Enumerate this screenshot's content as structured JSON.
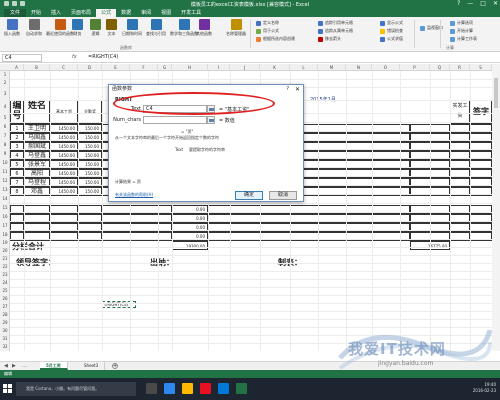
{
  "window": {
    "title": "模板员工的excel工资表模板.xlsx  [兼容模式] - Excel",
    "controls": [
      "?",
      "—",
      "□",
      "✕"
    ]
  },
  "ribbon": {
    "tabs": [
      {
        "label": "文件",
        "kind": "file"
      },
      {
        "label": "开始",
        "kind": "normal"
      },
      {
        "label": "插入",
        "kind": "normal"
      },
      {
        "label": "页面布局",
        "kind": "normal"
      },
      {
        "label": "公式",
        "kind": "active"
      },
      {
        "label": "数据",
        "kind": "normal"
      },
      {
        "label": "审阅",
        "kind": "normal"
      },
      {
        "label": "视图",
        "kind": "normal"
      },
      {
        "label": "开发工具",
        "kind": "normal"
      }
    ],
    "big_buttons": [
      {
        "label": "插入函数",
        "color": "#4472c4"
      },
      {
        "label": "自动求和",
        "color": "#6d6d6d"
      },
      {
        "label": "最近使用的函数",
        "color": "#c55a11"
      },
      {
        "label": "财务",
        "color": "#2e75b6"
      },
      {
        "label": "逻辑",
        "color": "#548235"
      },
      {
        "label": "文本",
        "color": "#7f6000"
      },
      {
        "label": "日期和时间",
        "color": "#2e75b6"
      },
      {
        "label": "查找与引用",
        "color": "#2e75b6"
      },
      {
        "label": "数学和三角函数",
        "color": "#2e75b6"
      },
      {
        "label": "其他函数",
        "color": "#7030a0"
      },
      {
        "label": "名称管理器",
        "color": "#bf8f00"
      }
    ],
    "small_buttons": [
      {
        "label": "定义名称",
        "color": "#4472c4"
      },
      {
        "label": "用于公式",
        "color": "#70ad47"
      },
      {
        "label": "根据所选内容创建",
        "color": "#ed7d31"
      },
      {
        "label": "追踪引用单元格",
        "color": "#4472c4"
      },
      {
        "label": "追踪从属单元格",
        "color": "#4472c4"
      },
      {
        "label": "移去箭头",
        "color": "#c00000"
      },
      {
        "label": "显示公式",
        "color": "#4472c4"
      },
      {
        "label": "错误检查",
        "color": "#ffc000"
      },
      {
        "label": "公式求值",
        "color": "#4472c4"
      },
      {
        "label": "监视窗口",
        "color": "#5b9bd5"
      },
      {
        "label": "计算选项",
        "color": "#5b9bd5"
      },
      {
        "label": "开始计算",
        "color": "#5b9bd5"
      },
      {
        "label": "计算工作表",
        "color": "#5b9bd5"
      }
    ],
    "groups": [
      "函数库",
      "计算"
    ]
  },
  "formula_bar": {
    "name_box": "C4",
    "fx": "fx",
    "formula": "=RIGHT(C4)"
  },
  "grid": {
    "columns": [
      "A",
      "B",
      "C",
      "D",
      "E",
      "F",
      "G",
      "H",
      "I",
      "J",
      "K",
      "L",
      "M",
      "N",
      "O",
      "P",
      "Q",
      "R",
      "S"
    ],
    "rows": [
      "1",
      "2",
      "3",
      "4",
      "5",
      "6",
      "7",
      "8",
      "9",
      "10",
      "11",
      "12",
      "13",
      "14",
      "15",
      "16",
      "17",
      "18",
      "19",
      "20",
      "21",
      "22",
      "23",
      "24",
      "25",
      "26",
      "27",
      "28",
      "29",
      "30",
      "31",
      "32",
      "33",
      "34"
    ]
  },
  "sheet": {
    "header_number": "编号",
    "header_name": "姓名",
    "header_basic": "基本工资",
    "header_total": "全勤奖",
    "header_real": "实发工资",
    "header_sign": "签字",
    "date_label": "2015年1月",
    "employees": [
      {
        "num": "1",
        "name": "王卫明",
        "basic": "1450.00",
        "total": "150.00"
      },
      {
        "num": "2",
        "name": "马国鑫",
        "basic": "1450.00",
        "total": "150.00"
      },
      {
        "num": "3",
        "name": "郝国斌",
        "basic": "1450.00",
        "total": "150.00"
      },
      {
        "num": "4",
        "name": "马登鑫",
        "basic": "1450.00",
        "total": "150.00"
      },
      {
        "num": "5",
        "name": "张景军",
        "basic": "1450.00",
        "total": "150.00"
      },
      {
        "num": "6",
        "name": "高阳",
        "basic": "1450.00",
        "total": "150.00"
      },
      {
        "num": "7",
        "name": "马登程",
        "basic": "1450.00",
        "total": "150.00"
      },
      {
        "num": "8",
        "name": "邓鑫",
        "basic": "1450.00",
        "total": "150.00"
      }
    ],
    "extra_values": [
      "0.00",
      "0.00",
      "0.00",
      "0.00"
    ],
    "subtotal_label": "分栏合计",
    "subtotal_value": "19300.00",
    "subtotal_right": "16775.00",
    "sign_leader": "领导签字：",
    "sign_cashier": "出纳：",
    "sign_maker": "制表：",
    "selected_cell_text": "=RIGHT(C4)"
  },
  "dialog": {
    "title": "函数参数",
    "help": "?",
    "close": "✕",
    "function_name": "RIGHT",
    "arg1_label": "Text",
    "arg1_value": "C4",
    "arg1_result": "= \"基本工资\"",
    "arg2_label": "Num_chars",
    "arg2_result": "= 数值",
    "result_preview": "= \"资\"",
    "description": "从一个文本字符串的最后一个字符开始返回指定个数的字符",
    "arg_help_label": "Text",
    "arg_help": "要提取字符的字符串",
    "calc_result": "计算结果 = 资",
    "help_link": "有关该函数的帮助(H)",
    "ok": "确定",
    "cancel": "取消"
  },
  "sheet_tabs": {
    "tabs": [
      "5月工资",
      "Sheet3"
    ],
    "add": "+"
  },
  "statusbar": {
    "text": "编辑"
  },
  "taskbar": {
    "search_placeholder": "我是 Cortana，小娜。有问题尽管问我。",
    "time": "19:40",
    "date": "2016-02-23",
    "apps": [
      {
        "color": "#4a4a4a"
      },
      {
        "color": "#2d89ef"
      },
      {
        "color": "#ffb900"
      },
      {
        "color": "#e81123"
      },
      {
        "color": "#0078d7"
      },
      {
        "color": "#217346"
      }
    ]
  },
  "watermark": {
    "text": "我爱IT技术网",
    "url": "jingyan.baidu.com"
  }
}
